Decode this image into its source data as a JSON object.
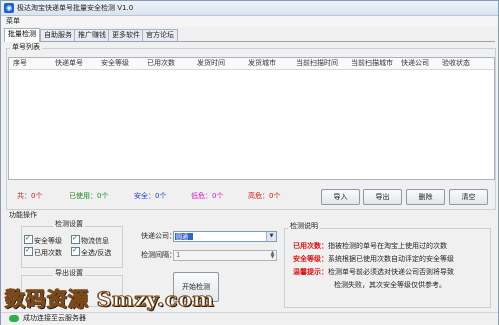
{
  "window": {
    "title": "极达淘宝快递单号批量安全检测 V1.0"
  },
  "menu": {
    "items": [
      {
        "label": "菜单"
      }
    ]
  },
  "tabs": [
    {
      "label": "批量检测",
      "active": true
    },
    {
      "label": "自助服务"
    },
    {
      "label": "推广赚钱"
    },
    {
      "label": "更多软件"
    },
    {
      "label": "官方论坛"
    }
  ],
  "list_group": {
    "title": "单号列表"
  },
  "table": {
    "columns": [
      "序号",
      "快递单号",
      "安全等级",
      "已用次数",
      "发货时间",
      "发货城市",
      "当前扫描时间",
      "当前扫描城市",
      "快递公司",
      "验收状态"
    ],
    "rows": []
  },
  "stats": [
    {
      "label": "共：0个",
      "color": "#d11a1a"
    },
    {
      "label": "已使用：0个",
      "color": "#1a8a1a"
    },
    {
      "label": "安全：0个",
      "color": "#1a3ad1"
    },
    {
      "label": "低危：0个",
      "color": "#d11ab8"
    },
    {
      "label": "高危：0个",
      "color": "#d11a1a"
    }
  ],
  "actions": {
    "import": "导入",
    "export": "导出",
    "delete": "删除",
    "clear": "清空"
  },
  "function_group": {
    "title": "功能操作"
  },
  "check_settings": {
    "title": "检测设置",
    "options": [
      {
        "label": "安全等级",
        "checked": true
      },
      {
        "label": "物流信息",
        "checked": true
      },
      {
        "label": "已用次数",
        "checked": true
      },
      {
        "label": "全选/反选",
        "checked": true
      }
    ]
  },
  "export_settings": {
    "title": "导出设置"
  },
  "courier": {
    "label": "快递公司：",
    "value": "圆通"
  },
  "interval": {
    "label": "检测间隔：",
    "value": "1"
  },
  "start_button": {
    "label": "开始检测"
  },
  "notes": {
    "title": "检测说明",
    "lines": [
      {
        "key": "已用次数：",
        "text": "指被检测的单号在淘宝上使用过的次数"
      },
      {
        "key": "安全等级：",
        "text": "系统根据已使用次数自动评定的安全等级"
      },
      {
        "key": "温馨提示：",
        "text": "检测单号前必须选对快递公司否则将导致"
      },
      {
        "key": "",
        "text": "检测失败，其次安全等级仅供参考。"
      }
    ]
  },
  "watermark": "数码资源 Smzy.com",
  "status": {
    "text": "成功连接至云服务器"
  }
}
